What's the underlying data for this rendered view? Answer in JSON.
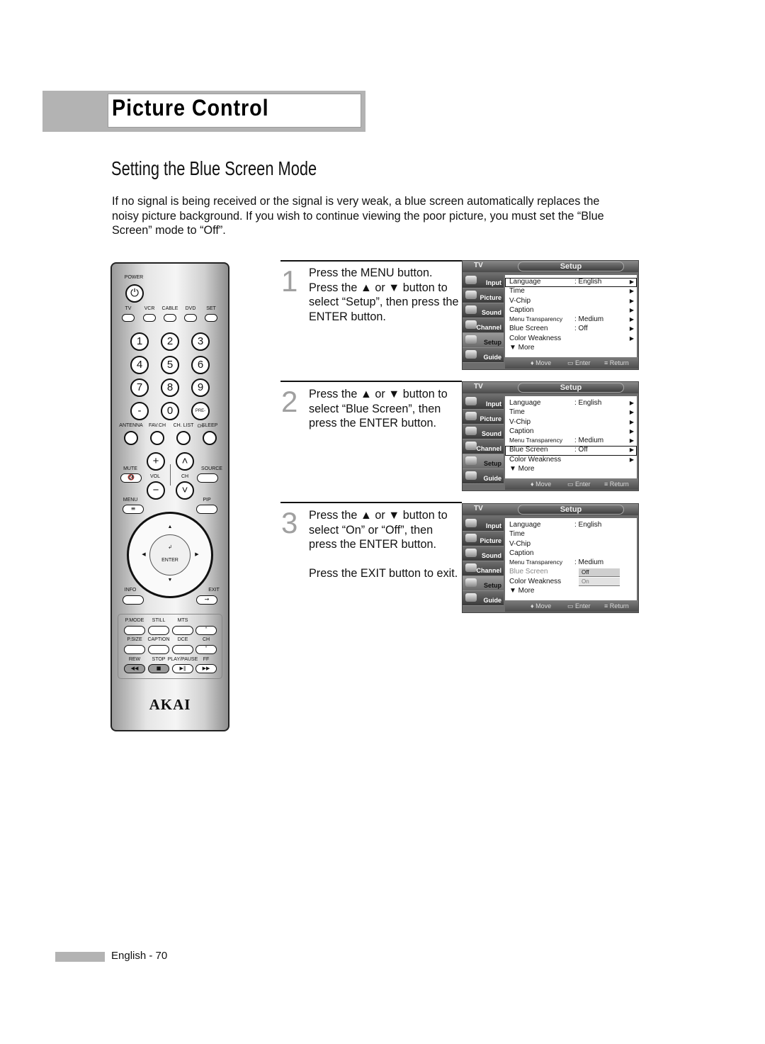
{
  "header": {
    "title": "Picture Control"
  },
  "section_title": "Setting the Blue Screen Mode",
  "intro": "If no signal is being received or the signal is very weak, a blue screen automatically replaces the noisy picture background. If you wish to continue viewing the poor picture, you must set the “Blue Screen” mode to “Off”.",
  "steps": [
    {
      "number": "1",
      "text": "Press the MENU button.\nPress the ▲ or ▼ button to select “Setup”, then press the ENTER button."
    },
    {
      "number": "2",
      "text": "Press the ▲ or ▼ button to select “Blue Screen”, then press the ENTER button."
    },
    {
      "number": "3",
      "text": "Press the ▲ or ▼ button to select “On” or “Off”, then press the ENTER button.\n\nPress the EXIT button to exit."
    }
  ],
  "osd": {
    "tv_label": "TV",
    "menu_title": "Setup",
    "sidebar": [
      "Input",
      "Picture",
      "Sound",
      "Channel",
      "Setup",
      "Guide"
    ],
    "active_sidebar": "Setup",
    "items": [
      {
        "label": "Language",
        "value": ": English"
      },
      {
        "label": "Time",
        "value": ""
      },
      {
        "label": "V-Chip",
        "value": ""
      },
      {
        "label": "Caption",
        "value": ""
      },
      {
        "label": "Menu Transparency",
        "value": ": Medium"
      },
      {
        "label": "Blue Screen",
        "value": ": Off"
      },
      {
        "label": "Color Weakness",
        "value": ""
      },
      {
        "label": "▼ More",
        "value": ""
      }
    ],
    "screens": [
      {
        "highlighted": "Language"
      },
      {
        "highlighted": "Blue Screen"
      },
      {
        "highlighted": "Blue Screen",
        "options": [
          "Off",
          "On"
        ],
        "selected_option": "Off"
      }
    ],
    "footer": {
      "move": "Move",
      "enter": "Enter",
      "return": "Return"
    }
  },
  "remote": {
    "brand": "AKAI",
    "labels": {
      "power": "POWER",
      "tv": "TV",
      "vcr": "VCR",
      "cable": "CABLE",
      "dvd": "DVD",
      "set": "SET",
      "antenna": "ANTENNA",
      "favch": "FAV.CH",
      "chlist": "CH. LIST",
      "sleep": "SLEEP",
      "mute": "MUTE",
      "vol": "VOL",
      "ch": "CH",
      "source": "SOURCE",
      "menu": "MENU",
      "pip": "PIP",
      "enter": "ENTER",
      "info": "INFO",
      "exit": "EXIT",
      "pmode": "P.MODE",
      "still": "STILL",
      "mts": "MTS",
      "psize": "P.SIZE",
      "caption": "CAPTION",
      "dce": "DCE",
      "ch2": "CH",
      "rew": "REW",
      "stop": "STOP",
      "playpause": "PLAY/PAUSE",
      "ff": "FF",
      "prech": "PRE-CH",
      "dash": "-"
    },
    "digits": [
      "1",
      "2",
      "3",
      "4",
      "5",
      "6",
      "7",
      "8",
      "9"
    ],
    "zero": "0"
  },
  "footer": {
    "page_label": "English - 70"
  }
}
